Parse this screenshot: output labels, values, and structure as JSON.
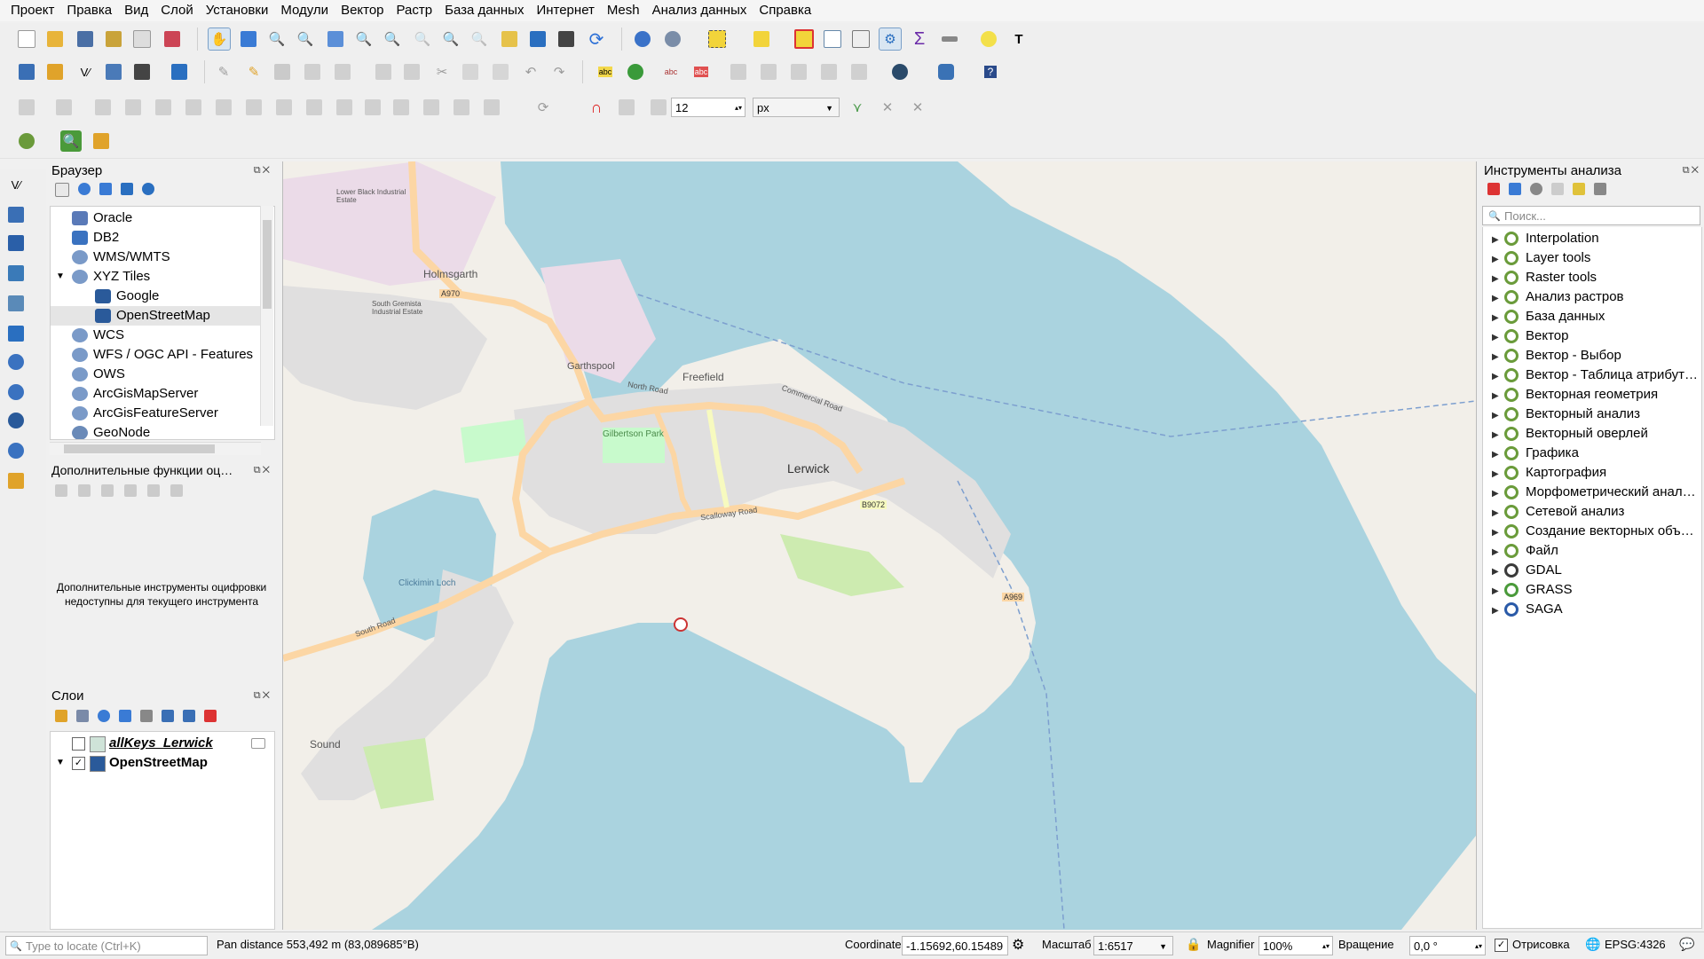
{
  "menu": [
    "Проект",
    "Правка",
    "Вид",
    "Слой",
    "Установки",
    "Модули",
    "Вектор",
    "Растр",
    "База данных",
    "Интернет",
    "Mesh",
    "Анализ данных",
    "Справка"
  ],
  "snapping": {
    "tolerance": "12",
    "units": "px"
  },
  "browser": {
    "title": "Браузер",
    "items": [
      {
        "label": "Oracle",
        "icon": "oracle-icon",
        "indent": 0
      },
      {
        "label": "DB2",
        "icon": "db2-icon",
        "indent": 0
      },
      {
        "label": "WMS/WMTS",
        "icon": "globe-icon",
        "indent": 0
      },
      {
        "label": "XYZ Tiles",
        "icon": "globe-icon",
        "indent": 0,
        "expanded": true
      },
      {
        "label": "Google",
        "icon": "tiles-icon",
        "indent": 1
      },
      {
        "label": "OpenStreetMap",
        "icon": "tiles-icon",
        "indent": 1,
        "selected": true
      },
      {
        "label": "WCS",
        "icon": "globe-icon",
        "indent": 0
      },
      {
        "label": "WFS / OGC API - Features",
        "icon": "globe-icon",
        "indent": 0
      },
      {
        "label": "OWS",
        "icon": "globe-icon",
        "indent": 0
      },
      {
        "label": "ArcGisMapServer",
        "icon": "globe-icon",
        "indent": 0
      },
      {
        "label": "ArcGisFeatureServer",
        "icon": "globe-icon",
        "indent": 0
      },
      {
        "label": "GeoNode",
        "icon": "geonode-icon",
        "indent": 0
      }
    ]
  },
  "advdig": {
    "title": "Дополнительные функции оц…",
    "message": "Дополнительные инструменты оцифровки недоступны для текущего инструмента"
  },
  "layers": {
    "title": "Слои",
    "items": [
      {
        "label": "allKeys_Lerwick",
        "checked": false
      },
      {
        "label": "OpenStreetMap",
        "checked": true
      }
    ]
  },
  "processing": {
    "title": "Инструменты анализа",
    "search_placeholder": "Поиск...",
    "items": [
      "Interpolation",
      "Layer tools",
      "Raster tools",
      "Анализ растров",
      "База данных",
      "Вектор",
      "Вектор - Выбор",
      "Вектор - Таблица атрибут…",
      "Векторная геометрия",
      "Векторный анализ",
      "Векторный оверлей",
      "Графика",
      "Картография",
      "Морфометрический анал…",
      "Сетевой анализ",
      "Создание векторных объ…",
      "Файл",
      "GDAL",
      "GRASS",
      "SAGA"
    ]
  },
  "map_labels": [
    "Lerwick",
    "Freefield",
    "Gilbertson Park",
    "Holmsgarth",
    "Garthspool",
    "North Road",
    "Commercial Road",
    "Scalloway Road",
    "South Road",
    "A970",
    "A969",
    "B9072",
    "Sound",
    "Clickimin Loch",
    "Lower Black Industrial Estate",
    "South Gremista Industrial Estate"
  ],
  "status": {
    "locate_placeholder": "Type to locate (Ctrl+K)",
    "message": "Pan distance 553,492 m (83,089685°B)",
    "coordinate_label": "Coordinate",
    "coordinate": "-1.15692,60.15489",
    "scale_label": "Масштаб",
    "scale": "1:6517",
    "magnifier_label": "Magnifier",
    "magnifier": "100%",
    "rotation_label": "Вращение",
    "rotation": "0,0 °",
    "render_label": "Отрисовка",
    "crs": "EPSG:4326"
  }
}
